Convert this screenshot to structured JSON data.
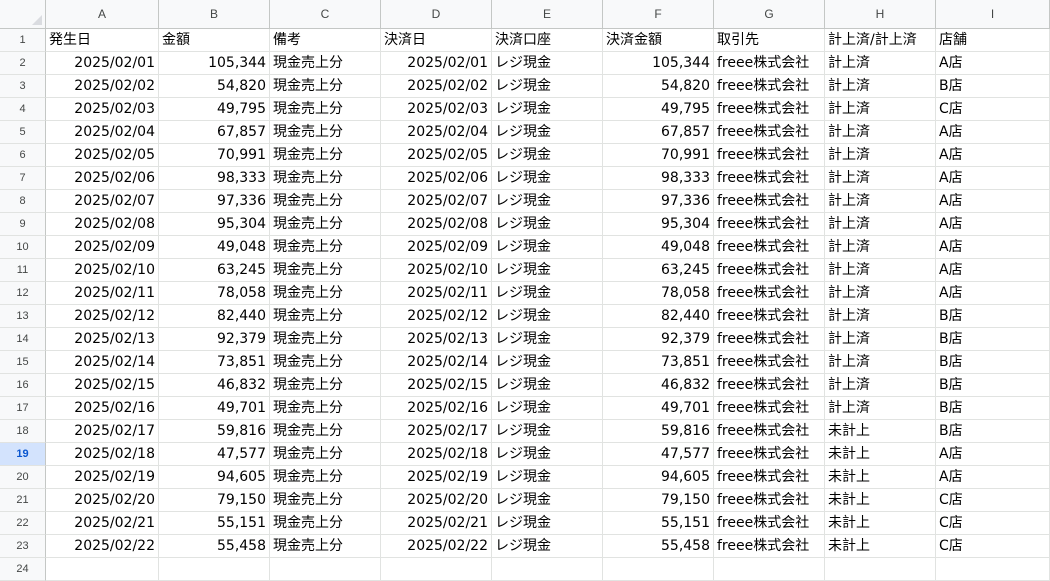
{
  "columns": [
    "A",
    "B",
    "C",
    "D",
    "E",
    "F",
    "G",
    "H",
    "I"
  ],
  "selected_row": 19,
  "header_row": [
    "発生日",
    "金額",
    "備考",
    "決済日",
    "決済口座",
    "決済金額",
    "取引先",
    "計上済/計上済",
    "店舗"
  ],
  "rows": [
    [
      "2025/02/01",
      "105,344",
      "現金売上分",
      "2025/02/01",
      "レジ現金",
      "105,344",
      "freee株式会社",
      "計上済",
      "A店"
    ],
    [
      "2025/02/02",
      "54,820",
      "現金売上分",
      "2025/02/02",
      "レジ現金",
      "54,820",
      "freee株式会社",
      "計上済",
      "B店"
    ],
    [
      "2025/02/03",
      "49,795",
      "現金売上分",
      "2025/02/03",
      "レジ現金",
      "49,795",
      "freee株式会社",
      "計上済",
      "C店"
    ],
    [
      "2025/02/04",
      "67,857",
      "現金売上分",
      "2025/02/04",
      "レジ現金",
      "67,857",
      "freee株式会社",
      "計上済",
      "A店"
    ],
    [
      "2025/02/05",
      "70,991",
      "現金売上分",
      "2025/02/05",
      "レジ現金",
      "70,991",
      "freee株式会社",
      "計上済",
      "A店"
    ],
    [
      "2025/02/06",
      "98,333",
      "現金売上分",
      "2025/02/06",
      "レジ現金",
      "98,333",
      "freee株式会社",
      "計上済",
      "A店"
    ],
    [
      "2025/02/07",
      "97,336",
      "現金売上分",
      "2025/02/07",
      "レジ現金",
      "97,336",
      "freee株式会社",
      "計上済",
      "A店"
    ],
    [
      "2025/02/08",
      "95,304",
      "現金売上分",
      "2025/02/08",
      "レジ現金",
      "95,304",
      "freee株式会社",
      "計上済",
      "A店"
    ],
    [
      "2025/02/09",
      "49,048",
      "現金売上分",
      "2025/02/09",
      "レジ現金",
      "49,048",
      "freee株式会社",
      "計上済",
      "A店"
    ],
    [
      "2025/02/10",
      "63,245",
      "現金売上分",
      "2025/02/10",
      "レジ現金",
      "63,245",
      "freee株式会社",
      "計上済",
      "A店"
    ],
    [
      "2025/02/11",
      "78,058",
      "現金売上分",
      "2025/02/11",
      "レジ現金",
      "78,058",
      "freee株式会社",
      "計上済",
      "A店"
    ],
    [
      "2025/02/12",
      "82,440",
      "現金売上分",
      "2025/02/12",
      "レジ現金",
      "82,440",
      "freee株式会社",
      "計上済",
      "B店"
    ],
    [
      "2025/02/13",
      "92,379",
      "現金売上分",
      "2025/02/13",
      "レジ現金",
      "92,379",
      "freee株式会社",
      "計上済",
      "B店"
    ],
    [
      "2025/02/14",
      "73,851",
      "現金売上分",
      "2025/02/14",
      "レジ現金",
      "73,851",
      "freee株式会社",
      "計上済",
      "B店"
    ],
    [
      "2025/02/15",
      "46,832",
      "現金売上分",
      "2025/02/15",
      "レジ現金",
      "46,832",
      "freee株式会社",
      "計上済",
      "B店"
    ],
    [
      "2025/02/16",
      "49,701",
      "現金売上分",
      "2025/02/16",
      "レジ現金",
      "49,701",
      "freee株式会社",
      "計上済",
      "B店"
    ],
    [
      "2025/02/17",
      "59,816",
      "現金売上分",
      "2025/02/17",
      "レジ現金",
      "59,816",
      "freee株式会社",
      "未計上",
      "B店"
    ],
    [
      "2025/02/18",
      "47,577",
      "現金売上分",
      "2025/02/18",
      "レジ現金",
      "47,577",
      "freee株式会社",
      "未計上",
      "A店"
    ],
    [
      "2025/02/19",
      "94,605",
      "現金売上分",
      "2025/02/19",
      "レジ現金",
      "94,605",
      "freee株式会社",
      "未計上",
      "A店"
    ],
    [
      "2025/02/20",
      "79,150",
      "現金売上分",
      "2025/02/20",
      "レジ現金",
      "79,150",
      "freee株式会社",
      "未計上",
      "C店"
    ],
    [
      "2025/02/21",
      "55,151",
      "現金売上分",
      "2025/02/21",
      "レジ現金",
      "55,151",
      "freee株式会社",
      "未計上",
      "C店"
    ],
    [
      "2025/02/22",
      "55,458",
      "現金売上分",
      "2025/02/22",
      "レジ現金",
      "55,458",
      "freee株式会社",
      "未計上",
      "C店"
    ],
    [
      "",
      "",
      "",
      "",
      "",
      "",
      "",
      "",
      ""
    ]
  ]
}
